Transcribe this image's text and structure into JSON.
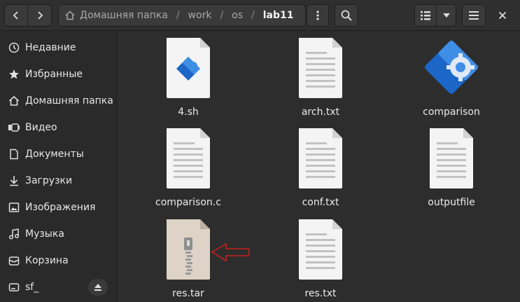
{
  "header": {
    "path": [
      "Домашняя папка",
      "work",
      "os",
      "lab11"
    ]
  },
  "sidebar": {
    "items": [
      {
        "label": "Недавние",
        "icon": "clock-icon"
      },
      {
        "label": "Избранные",
        "icon": "star-icon"
      },
      {
        "label": "Домашняя папка",
        "icon": "home-icon"
      },
      {
        "label": "Видео",
        "icon": "video-icon"
      },
      {
        "label": "Документы",
        "icon": "document-icon"
      },
      {
        "label": "Загрузки",
        "icon": "download-icon"
      },
      {
        "label": "Изображения",
        "icon": "image-icon"
      },
      {
        "label": "Музыка",
        "icon": "music-icon"
      },
      {
        "label": "Корзина",
        "icon": "trash-icon"
      },
      {
        "label": "sf_",
        "icon": "drive-icon"
      }
    ]
  },
  "files": [
    {
      "name": "4.sh",
      "type": "script"
    },
    {
      "name": "arch.txt",
      "type": "text"
    },
    {
      "name": "comparison",
      "type": "executable"
    },
    {
      "name": "comparison.c",
      "type": "text"
    },
    {
      "name": "conf.txt",
      "type": "text"
    },
    {
      "name": "outputfile",
      "type": "text"
    },
    {
      "name": "res.tar",
      "type": "archive"
    },
    {
      "name": "res.txt",
      "type": "text"
    }
  ],
  "colors": {
    "accent_blue": "#3584e4",
    "arrow_red": "#c81e1e"
  }
}
